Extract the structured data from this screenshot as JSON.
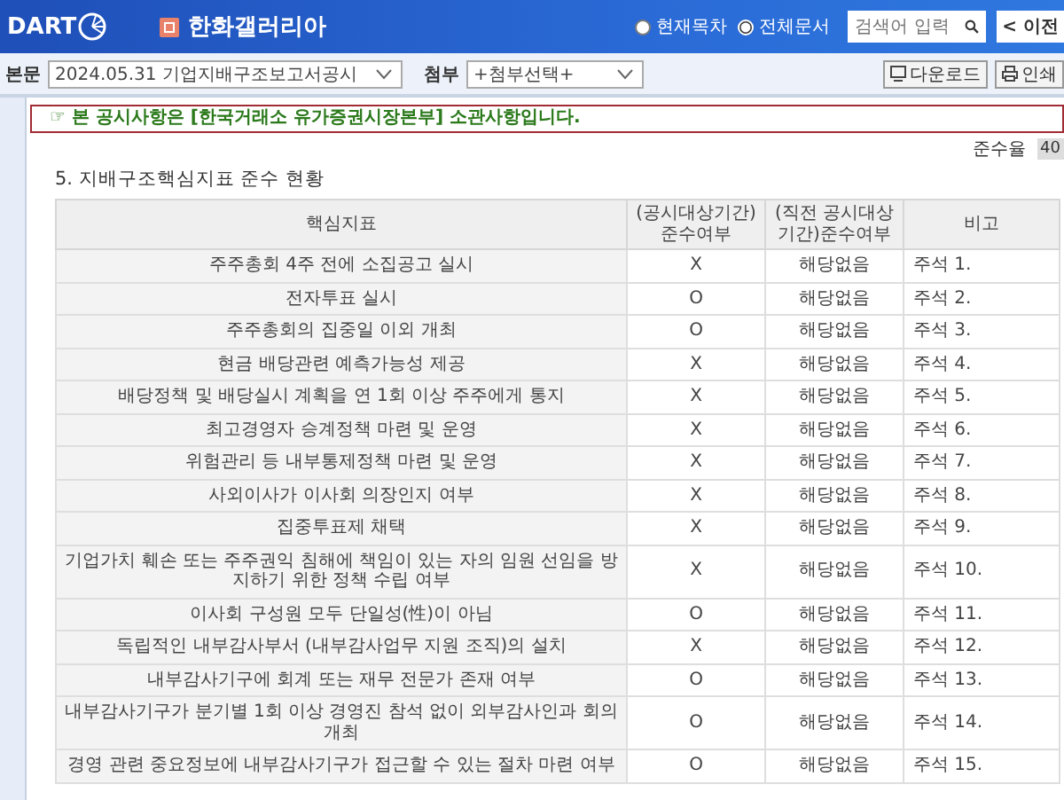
{
  "header": {
    "logo": "DART",
    "company": "한화갤러리아",
    "scope_options": [
      {
        "label": "현재목차",
        "selected": false
      },
      {
        "label": "전체문서",
        "selected": true
      }
    ],
    "search": {
      "placeholder": "검색어 입력"
    },
    "prev_button": {
      "arrow": "<",
      "label": "이전"
    }
  },
  "toolbar": {
    "body_label": "본문",
    "body_select": "2024.05.31 기업지배구조보고서공시",
    "attachment_label": "첨부",
    "attachment_select": "+첨부선택+",
    "buttons": [
      {
        "kind": "download",
        "label": "다운로드"
      },
      {
        "kind": "print",
        "label": "인쇄"
      }
    ]
  },
  "notice": "☞ 본 공시사항은 [한국거래소 유가증권시장본부] 소관사항입니다.",
  "compliance": {
    "label": "준수율",
    "value": "40"
  },
  "section_title": "5. 지배구조핵심지표 준수 현황",
  "table": {
    "columns": [
      "핵심지표",
      "(공시대상기간) 준수여부",
      "(직전 공시대상 기간)준수여부",
      "비고"
    ],
    "rows": [
      {
        "indicator": "주주총회 4주 전에 소집공고 실시",
        "current": "X",
        "previous": "해당없음",
        "note": "주석 1."
      },
      {
        "indicator": "전자투표 실시",
        "current": "O",
        "previous": "해당없음",
        "note": "주석 2."
      },
      {
        "indicator": "주주총회의 집중일 이외 개최",
        "current": "O",
        "previous": "해당없음",
        "note": "주석 3."
      },
      {
        "indicator": "현금 배당관련 예측가능성 제공",
        "current": "X",
        "previous": "해당없음",
        "note": "주석 4."
      },
      {
        "indicator": "배당정책 및 배당실시 계획을 연 1회 이상 주주에게 통지",
        "current": "X",
        "previous": "해당없음",
        "note": "주석 5."
      },
      {
        "indicator": "최고경영자 승계정책 마련 및 운영",
        "current": "X",
        "previous": "해당없음",
        "note": "주석 6."
      },
      {
        "indicator": "위험관리 등 내부통제정책 마련 및 운영",
        "current": "X",
        "previous": "해당없음",
        "note": "주석 7."
      },
      {
        "indicator": "사외이사가 이사회 의장인지 여부",
        "current": "X",
        "previous": "해당없음",
        "note": "주석 8."
      },
      {
        "indicator": "집중투표제 채택",
        "current": "X",
        "previous": "해당없음",
        "note": "주석 9."
      },
      {
        "indicator": "기업가치 훼손 또는 주주권익 침해에 책임이 있는 자의 임원 선임을 방지하기 위한 정책 수립 여부",
        "current": "X",
        "previous": "해당없음",
        "note": "주석 10."
      },
      {
        "indicator": "이사회 구성원 모두 단일성(性)이 아님",
        "current": "O",
        "previous": "해당없음",
        "note": "주석 11."
      },
      {
        "indicator": "독립적인 내부감사부서 (내부감사업무 지원 조직)의 설치",
        "current": "X",
        "previous": "해당없음",
        "note": "주석 12."
      },
      {
        "indicator": "내부감사기구에 회계 또는 재무 전문가 존재 여부",
        "current": "O",
        "previous": "해당없음",
        "note": "주석 13."
      },
      {
        "indicator": "내부감사기구가 분기별 1회 이상 경영진 참석 없이 외부감사인과 회의 개최",
        "current": "O",
        "previous": "해당없음",
        "note": "주석 14."
      },
      {
        "indicator": "경영 관련 중요정보에 내부감사기구가 접근할 수 있는 절차 마련 여부",
        "current": "O",
        "previous": "해당없음",
        "note": "주석 15."
      }
    ]
  }
}
